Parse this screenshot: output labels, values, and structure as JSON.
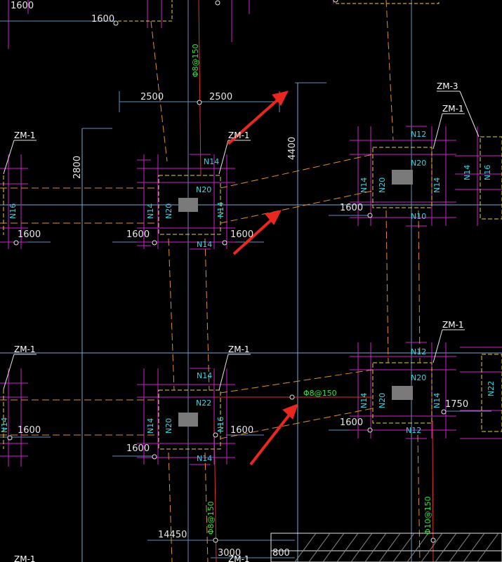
{
  "colors": {
    "background": "#000000",
    "axis_line": "#7aa7d6",
    "dim_line": "#5f8ec0",
    "magenta": "#cc22cc",
    "yellow_dash": "#e8d23a",
    "orange_dash": "#e0902a",
    "red_line": "#e03030",
    "arrow": "#e8281e",
    "column": "#7a7a7a",
    "text_white": "#e6e6e6",
    "text_cyan": "#35d6e6",
    "text_green": "#2fe63a"
  },
  "dimensions": {
    "d_1600_tl": "1600",
    "d_1600_t2": "1600",
    "d_2500_l": "2500",
    "d_2500_r": "2500",
    "d_4400": "4400",
    "d_2800": "2800",
    "d_1600_a": "1600",
    "d_1600_b": "1600",
    "d_1600_c": "1600",
    "d_1600_d": "1600",
    "d_1600_e": "1600",
    "d_1600_f": "1600",
    "d_1600_g": "1600",
    "d_1600_h": "1600",
    "d_1750": "1750",
    "d_14450": "14450",
    "d_3000": "3000",
    "d_800": "800"
  },
  "labels": {
    "zm1_a": "ZM-1",
    "zm1_b": "ZM-1",
    "zm3": "ZM-3",
    "zm1_c": "ZM-1",
    "zm1_d": "ZM-1",
    "zm1_e": "ZM-1",
    "zm1_f": "ZM-1",
    "zm1_g": "ZM-1",
    "zm1_h": "ZM-1"
  },
  "bar_marks": {
    "f1_top": "N14",
    "f1_in": "N20",
    "f1_left": "N14",
    "f1_left2": "N20",
    "f1_right": "N14",
    "f1_bot": "N14",
    "fl_left": "N16",
    "f2_top": "N12",
    "f2_in": "N20",
    "f2_left": "N14",
    "f2_left2": "N20",
    "f2_right": "N14",
    "f2_bot": "N10",
    "f2_far": "N14",
    "f2_far2": "N16",
    "f3_top": "N14",
    "f3_in": "N22",
    "f3_left": "N14",
    "f3_left2": "N20",
    "f3_right": "N16",
    "f3_bot": "N14",
    "fl2_left": "N14",
    "f4_top": "N12",
    "f4_in": "N20",
    "f4_left": "N14",
    "f4_left2": "N20",
    "f4_right": "N14",
    "f4_bot": "N12",
    "f4_far": "N22"
  },
  "rebar_specs": {
    "top_vertical": "Φ8@150",
    "middle_tie": "Φ8@150",
    "bottom_left": "Φ8@150",
    "bottom_right": "Φ10@150"
  }
}
